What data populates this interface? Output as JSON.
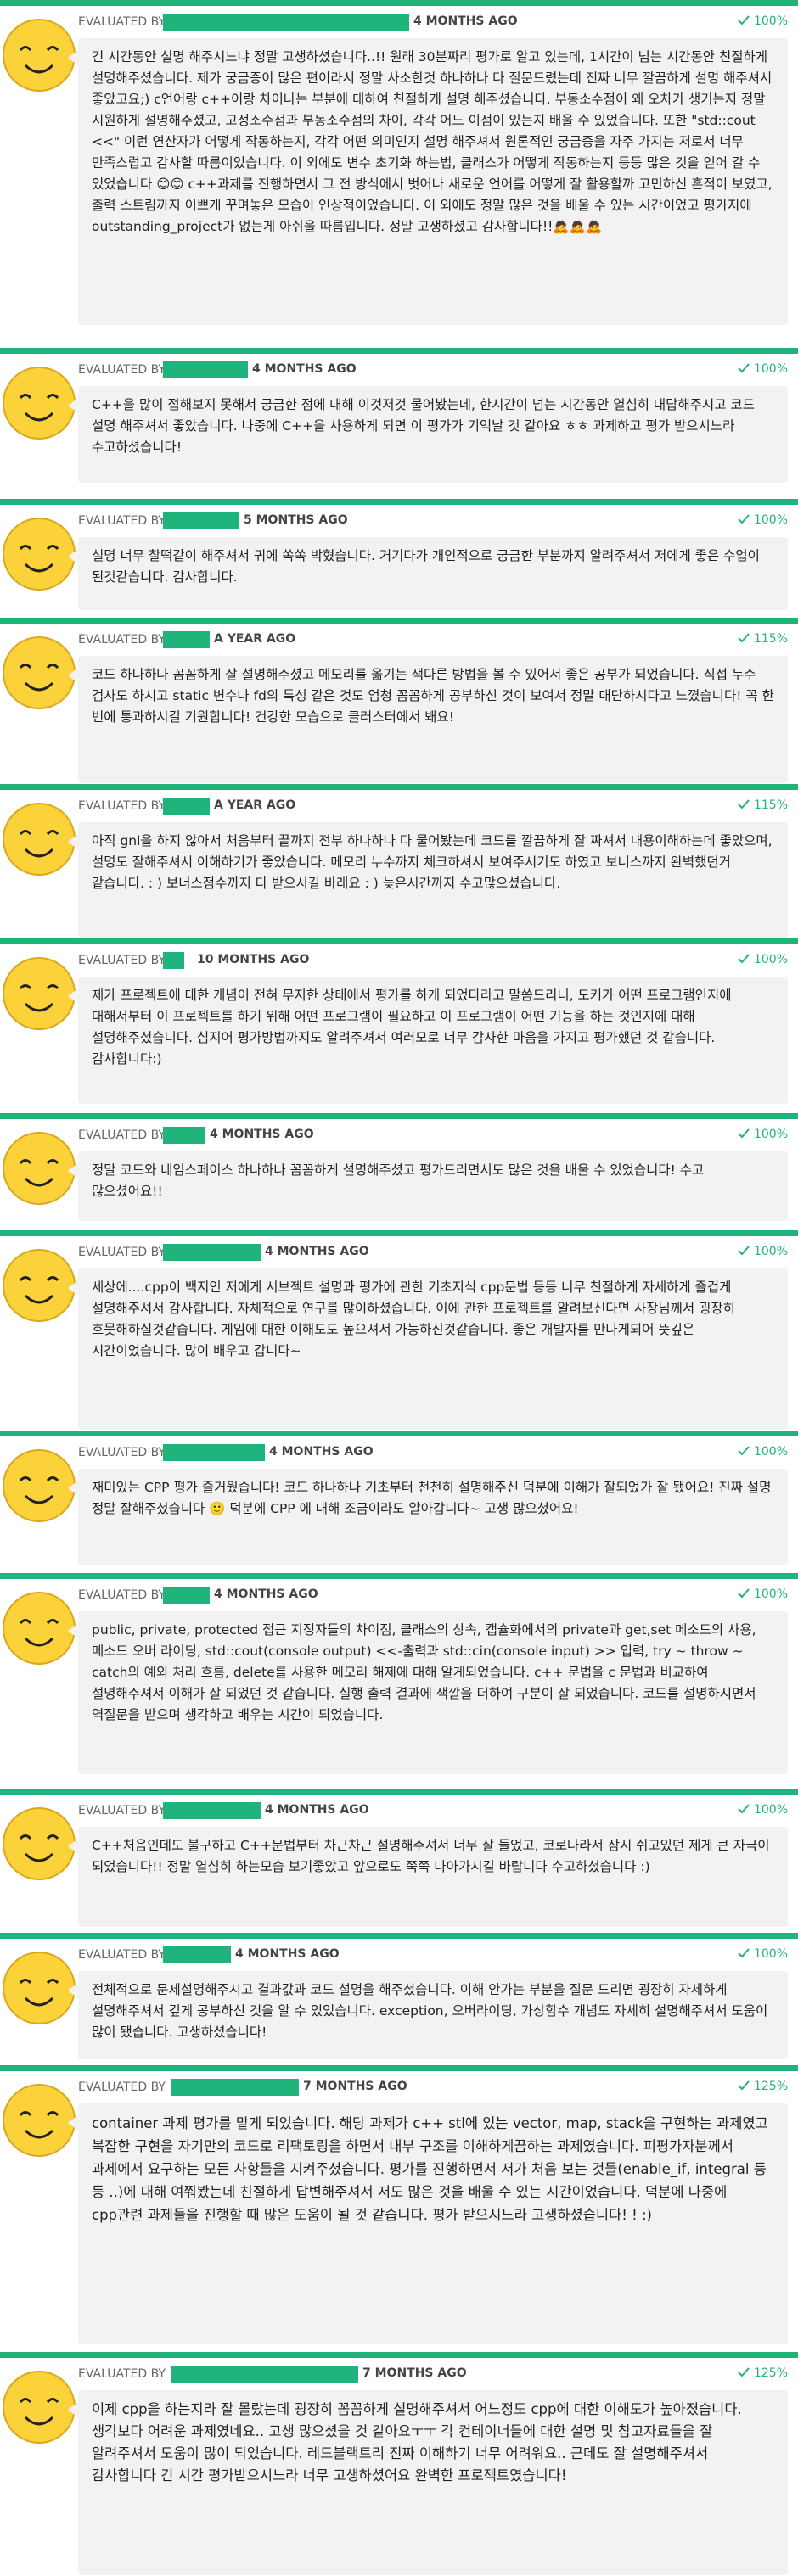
{
  "evaluated_by_label": "EVALUATED BY",
  "colors": {
    "accent": "#1fb47c",
    "bubble": "#f2f2f2",
    "face": "#fbd23a"
  },
  "reviews": [
    {
      "time": "4 MONTHS AGO",
      "score": "100%",
      "text": "긴 시간동안 설명 해주시느냐 정말 고생하셨습니다..!! 원래 30분짜리 평가로 알고 있는데, 1시간이 넘는 시간동안 친절하게 설명해주셨습니다. 제가 궁금증이 많은 편이라서 정말 사소한것 하나하나 다 질문드렸는데 진짜 너무 깔끔하게 설명 해주셔서 좋았고요;) c언어랑 c++이랑 차이나는 부분에 대하여 친절하게 설명 해주셨습니다. 부동소수점이 왜 오차가 생기는지 정말 시원하게 설명해주셨고, 고정소수점과 부동소수점의 차이, 각각 어느 이점이 있는지 배울 수 있었습니다. 또한 \"std::cout <<\" 이런 연산자가 어떻게 작동하는지, 각각 어떤 의미인지 설명 해주셔서 원론적인 궁금증을 자주 가지는 저로서 너무 만족스럽고 감사할 따름이었습니다. 이 외에도 변수 초기화 하는법, 클래스가 어떻게 작동하는지 등등 많은 것을 얻어 갈 수 있었습니다 😊😊 c++과제를 진행하면서 그 전 방식에서 벗어나 새로운 언어를 어떻게 잘 활용할까 고민하신 흔적이 보였고, 출력 스트림까지 이쁘게 꾸며놓은 모습이 인상적이었습니다. 이 외에도 정말 많은 것을 배울 수 있는 시간이었고 평가지에 outstanding_project가 없는게 아쉬울 따름입니다. 정말 고생하셨고 감사합니다!!🙇🙇🙇"
    },
    {
      "time": "4 MONTHS AGO",
      "score": "100%",
      "text": "C++을 많이 접해보지 못해서 궁금한 점에 대해 이것저것 물어봤는데, 한시간이 넘는 시간동안 열심히 대답해주시고 코드 설명 해주셔서 좋았습니다. 나중에 C++을 사용하게 되면 이 평가가 기억날 것 같아요 ㅎㅎ 과제하고 평가 받으시느라 수고하셨습니다!"
    },
    {
      "time": "5 MONTHS AGO",
      "score": "100%",
      "text": "설명 너무 찰떡같이 해주셔서 귀에 쏙쏙 박혔습니다. 거기다가 개인적으로 궁금한 부분까지 알려주셔서 저에게 좋은 수업이 된것같습니다. 감사합니다."
    },
    {
      "time": "A YEAR AGO",
      "score": "115%",
      "text": "코드 하나하나 꼼꼼하게 잘 설명해주셨고 메모리를 옮기는 색다른 방법을 볼 수 있어서 좋은 공부가 되었습니다. 직접 누수 검사도 하시고 static 변수나 fd의 특성 같은 것도 엄청 꼼꼼하게 공부하신 것이 보여서 정말 대단하시다고 느꼈습니다! 꼭 한 번에 통과하시길 기원합니다! 건강한 모습으로 클러스터에서 봬요!"
    },
    {
      "time": "A YEAR AGO",
      "score": "115%",
      "text": "아직 gnl을 하지 않아서 처음부터 끝까지 전부 하나하나 다 물어봤는데 코드를 깔끔하게 잘 짜셔서 내용이해하는데 좋았으며, 설명도 잘해주셔서 이해하기가 좋았습니다. 메모리 누수까지 체크하셔서 보여주시기도 하였고 보너스까지 완벽했던거 같습니다. : ) 보너스점수까지 다 받으시길 바래요 : ) 늦은시간까지 수고많으셨습니다."
    },
    {
      "time": "10 MONTHS AGO",
      "score": "100%",
      "text": "제가 프로젝트에 대한 개념이 전혀 무지한 상태에서 평가를 하게 되었다라고 말씀드리니, 도커가 어떤 프로그램인지에 대해서부터 이 프로젝트를 하기 위해 어떤 프로그램이 필요하고 이 프로그램이 어떤 기능을 하는 것인지에 대해 설명해주셨습니다. 심지어 평가방법까지도 알려주셔서 여러모로 너무 감사한 마음을 가지고 평가했던 것 같습니다. 감사합니다:)"
    },
    {
      "time": "4 MONTHS AGO",
      "score": "100%",
      "text": "정말 코드와 네임스페이스 하나하나 꼼꼼하게 설명해주셨고 평가드리면서도 많은 것을 배울 수 있었습니다! 수고 많으셨어요!!"
    },
    {
      "time": "4 MONTHS AGO",
      "score": "100%",
      "text": "세상에....cpp이 백지인 저에게 서브젝트 설명과 평가에 관한 기초지식 cpp문법 등등 너무 친절하게 자세하게 즐겁게 설명해주셔서 감사합니다. 자체적으로 연구를 많이하셨습니다. 이에 관한 프로젝트를 알려보신다면 사장님께서 굉장히 흐뭇해하실것같습니다. 게임에 대한 이해도도 높으셔서 가능하신것같습니다. 좋은 개발자를 만나게되어 뜻깊은 시간이었습니다. 많이 배우고 갑니다~"
    },
    {
      "time": "4 MONTHS AGO",
      "score": "100%",
      "text": "재미있는 CPP 평가 즐거웠습니다! 코드 하나하나 기초부터 천천히 설명해주신 덕분에 이해가 잘되었가 잘 됐어요! 진짜 설명 정말 잘해주셨습니다 🙂 덕분에 CPP 에 대해 조금이라도 알아갑니다~ 고생 많으셨어요!"
    },
    {
      "time": "4 MONTHS AGO",
      "score": "100%",
      "text": "public, private, protected 접근 지정자들의 차이점, 클래스의 상속, 캡슐화에서의 private과 get,set 메소드의 사용, 메소드 오버 라이딩, std::cout(console output) <<-출력과 std::cin(console input) >> 입력, try ~ throw ~ catch의 예외 처리 흐름, delete를 사용한 메모리 해제에 대해 알게되었습니다. c++ 문법을 c 문법과 비교하여 설명해주셔서 이해가 잘 되었던 것 같습니다. 실행 출력 결과에 색깔을 더하여 구분이 잘 되었습니다. 코드를 설명하시면서 역질문을 받으며 생각하고 배우는 시간이 되었습니다."
    },
    {
      "time": "4 MONTHS AGO",
      "score": "100%",
      "text": "C++처음인데도 불구하고 C++문법부터 차근차근 설명해주셔서 너무 잘 들었고, 코로나라서 잠시 쉬고있던 제게 큰 자극이 되었습니다!! 정말 열심히 하는모습 보기좋았고 앞으로도 쭉쭉 나아가시길 바랍니다 수고하셨습니다 :)"
    },
    {
      "time": "4 MONTHS AGO",
      "score": "100%",
      "text": "전체적으로 문제설명해주시고 결과값과 코드 설명을 해주셨습니다. 이해 안가는 부분을 질문 드리면 굉장히 자세하게 설명해주셔서 깊게 공부하신 것을 알 수 있었습니다. exception, 오버라이딩, 가상함수 개념도 자세히 설명해주셔서 도움이 많이 됐습니다. 고생하셨습니다!"
    },
    {
      "time": "7 MONTHS AGO",
      "score": "125%",
      "text": "container 과제 평가를 맡게 되었습니다. 해당 과제가 c++ stl에 있는 vector, map, stack을 구현하는 과제였고 복잡한 구현을 자기만의 코드로 리팩토링을 하면서 내부 구조를 이해하게끔하는 과제였습니다. 피평가자분께서 과제에서 요구하는 모든 사항들을 지켜주셨습니다. 평가를 진행하면서 저가 처음 보는 것들(enable_if, integral 등 등 ..)에 대해 여쭤봤는데 친절하게 답변해주셔서 저도 많은 것을 배울 수 있는 시간이었습니다. 덕분에 나중에 cpp관련 과제들을 진행할 때 많은 도움이 될 것 같습니다. 평가 받으시느라 고생하셨습니다! ! :)"
    },
    {
      "time": "7 MONTHS AGO",
      "score": "125%",
      "text": "이제 cpp을 하는지라 잘 몰랐는데 굉장히 꼼꼼하게 설명해주셔서 어느정도 cpp에 대한 이해도가 높아졌습니다. 생각보다 어려운 과제였네요.. 고생 많으셨을 것 같아요ㅜㅜ 각 컨테이너들에 대한 설명 및 참고자료들을 잘 알려주셔서 도움이 많이 되었습니다. 레드블랙트리 진짜 이해하기 너무 어려워요.. 근데도 잘 설명해주셔서 감사합니다 긴 시간 평가받으시느라 너무 고생하셨어요 완벽한 프로젝트였습니다!"
    }
  ]
}
